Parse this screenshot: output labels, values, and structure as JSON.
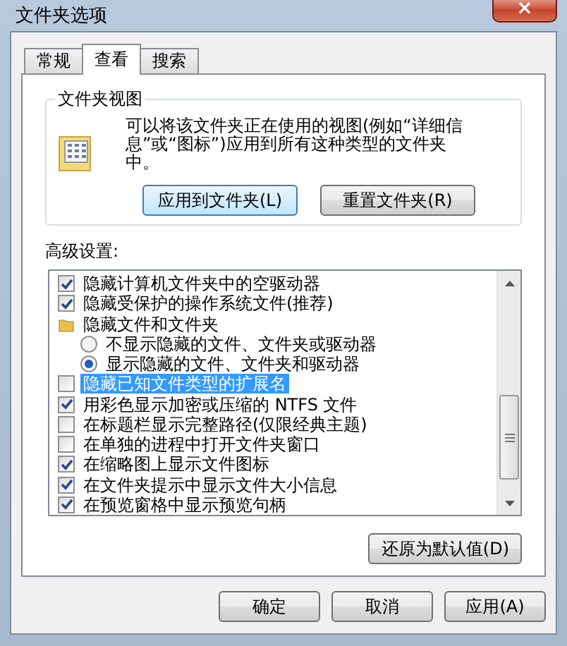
{
  "window": {
    "title": "文件夹选项",
    "close": "×"
  },
  "tabs": [
    {
      "label": "常规",
      "selected": false
    },
    {
      "label": "查看",
      "selected": true
    },
    {
      "label": "搜索",
      "selected": false
    }
  ],
  "folder_views": {
    "title": "文件夹视图",
    "description": "可以将该文件夹正在使用的视图(例如“详细信息”或“图标”)应用到所有这种类型的文件夹中。",
    "buttons": [
      "应用到文件夹(L)",
      "重置文件夹(R)"
    ]
  },
  "advanced": {
    "label": "高级设置:",
    "items": [
      {
        "kind": "checkbox",
        "label": "隐藏计算机文件夹中的空驱动器",
        "checked": true,
        "selected": false
      },
      {
        "kind": "checkbox",
        "label": "隐藏受保护的操作系统文件(推荐)",
        "checked": true,
        "selected": false
      },
      {
        "kind": "folder",
        "label": "隐藏文件和文件夹",
        "selected": false,
        "children": [
          {
            "kind": "radio",
            "label": "不显示隐藏的文件、文件夹或驱动器",
            "selected": false
          },
          {
            "kind": "radio",
            "label": "显示隐藏的文件、文件夹和驱动器",
            "selected": true
          }
        ]
      },
      {
        "kind": "checkbox",
        "label": "隐藏已知文件类型的扩展名",
        "checked": false,
        "selected": true
      },
      {
        "kind": "checkbox",
        "label": "用彩色显示加密或压缩的 NTFS 文件",
        "checked": true,
        "selected": false
      },
      {
        "kind": "checkbox",
        "label": "在标题栏显示完整路径(仅限经典主题)",
        "checked": false,
        "selected": false
      },
      {
        "kind": "checkbox",
        "label": "在单独的进程中打开文件夹窗口",
        "checked": false,
        "selected": false
      },
      {
        "kind": "checkbox",
        "label": "在缩略图上显示文件图标",
        "checked": true,
        "selected": false
      },
      {
        "kind": "checkbox",
        "label": "在文件夹提示中显示文件大小信息",
        "checked": true,
        "selected": false
      },
      {
        "kind": "checkbox",
        "label": "在预览窗格中显示预览句柄",
        "checked": true,
        "selected": false
      }
    ],
    "restore_button": "还原为默认值(D)"
  },
  "buttons": [
    "确定",
    "取消",
    "应用(A)"
  ]
}
